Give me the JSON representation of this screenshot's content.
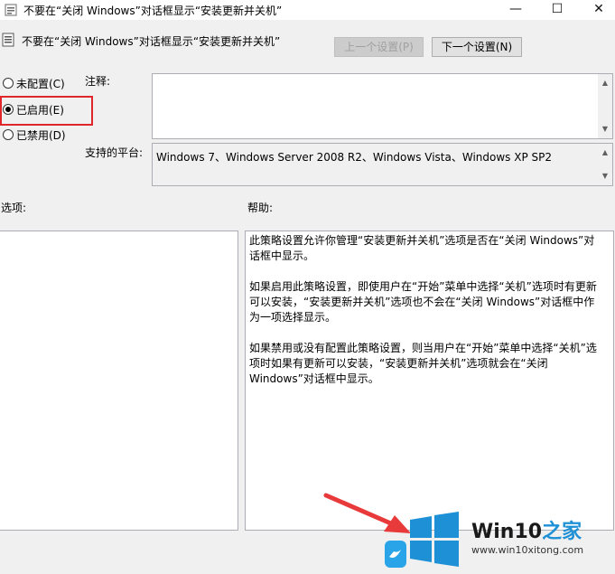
{
  "window": {
    "title": "不要在“关闭 Windows”对话框显示“安装更新并关机”",
    "minimize_glyph": "—",
    "maximize_glyph": "☐",
    "close_glyph": "✕"
  },
  "header": {
    "policy_title": "不要在“关闭 Windows”对话框显示“安装更新并关机”",
    "prev_button": "上一个设置(P)",
    "next_button": "下一个设置(N)"
  },
  "state": {
    "options": [
      {
        "label": "未配置(C)",
        "selected": false
      },
      {
        "label": "已启用(E)",
        "selected": true
      },
      {
        "label": "已禁用(D)",
        "selected": false
      }
    ]
  },
  "comment": {
    "label": "注释:",
    "value": ""
  },
  "platform": {
    "label": "支持的平台:",
    "value": "Windows 7、Windows Server 2008 R2、Windows Vista、Windows XP SP2"
  },
  "options_section": {
    "label": "选项:"
  },
  "help_section": {
    "label": "帮助:",
    "text": "此策略设置允许你管理“安装更新并关机”选项是否在“关闭 Windows”对话框中显示。\n\n如果启用此策略设置，即使用户在“开始”菜单中选择“关机”选项时有更新可以安装，“安装更新并关机”选项也不会在“关闭 Windows”对话框中作为一项选择显示。\n\n如果禁用或没有配置此策略设置，则当用户在“开始”菜单中选择“关机”选项时如果有更新可以安装，“安装更新并关机”选项就会在“关闭 Windows”对话框中显示。"
  },
  "watermark": {
    "brand": "Win10",
    "brand_suffix": "之家",
    "url": "www.win10xitong.com"
  },
  "colors": {
    "highlight": "#e0262a",
    "arrow": "#e83a3a",
    "logo_blue": "#1e90d6"
  }
}
